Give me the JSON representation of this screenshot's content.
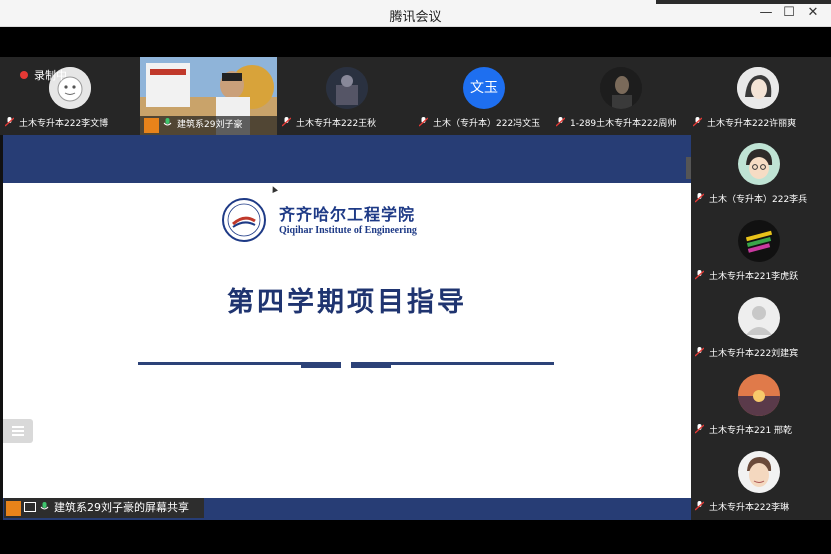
{
  "window": {
    "title": "腾讯会议"
  },
  "recording": {
    "label": "录制中"
  },
  "top_participants": [
    {
      "name": "土木专升本222李文博",
      "avatar": "gray-cartoon-avatar-icon"
    },
    {
      "name": "建筑系29刘子豪",
      "avatar": "camera-feed"
    },
    {
      "name": "土木专升本222王秋",
      "avatar": "dark-photo-avatar-icon"
    },
    {
      "name": "土木（专升本）222冯文玉",
      "avatar_text": "文玉",
      "avatar_color": "#1e6ff0"
    },
    {
      "name": "1-289土木专升本222周帅",
      "avatar": "dark-photo-avatar-icon"
    },
    {
      "name": "土木专升本222许丽爽",
      "avatar": "cartoon-girl-avatar-icon"
    }
  ],
  "right_participants": [
    {
      "name": "土木（专升本）222李兵",
      "avatar": "cartoon-boy-avatar-icon"
    },
    {
      "name": "土木专升本221李虎跃",
      "avatar": "colorful-avatar-icon"
    },
    {
      "name": "土木专升本222刘建宾",
      "avatar": "default-user-avatar-icon"
    },
    {
      "name": "土木专升本221 邢乾",
      "avatar": "sunset-avatar-icon"
    },
    {
      "name": "土木专升本222李琳",
      "avatar": "cartoon-face-avatar-icon"
    }
  ],
  "slide": {
    "school_cn": "齐齐哈尔工程学院",
    "school_en": "Qiqihar Institute of Engineering",
    "title": "第四学期项目指导"
  },
  "screen_share": {
    "label": "建筑系29刘子豪的屏幕共享"
  },
  "colors": {
    "slide_navy": "#273d75",
    "accent_blue": "#1e6ff0"
  }
}
